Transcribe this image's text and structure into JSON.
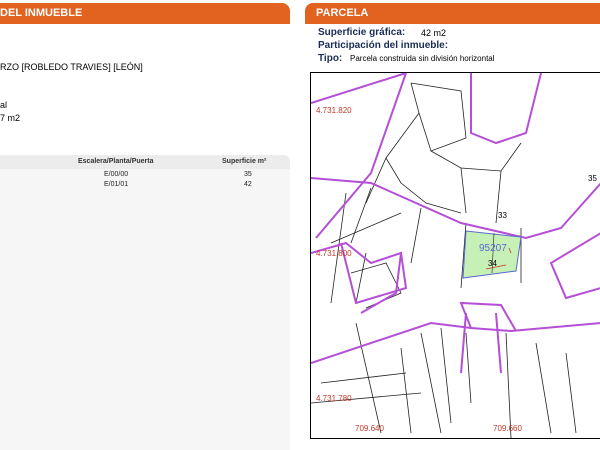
{
  "left_panel": {
    "header": "DEL INMUEBLE",
    "address_line": "RZO [ROBLEDO TRAVIES] [LEÓN]",
    "line1": "al",
    "line2": "7 m2",
    "table": {
      "columns": [
        "Escalera/Planta/Puerta",
        "Superficie m²"
      ],
      "rows": [
        {
          "location": "E/00/00",
          "area": "35"
        },
        {
          "location": "E/01/01",
          "area": "42"
        }
      ]
    }
  },
  "right_panel": {
    "header": "PARCELA",
    "surface_label": "Superficie gráfica:",
    "surface_value": "42 m2",
    "participation_label": "Participación del inmueble:",
    "type_label": "Tipo:",
    "type_value": "Parcela construida sin división horizontal"
  },
  "map": {
    "coord_top": "4.731.820",
    "coord_mid": "4.731.800",
    "coord_bot": "4.731.780",
    "coord_x1": "709.640",
    "coord_x2": "709.660",
    "parcel_ref": "95207",
    "label_34": "34",
    "label_33": "33",
    "label_35": "35",
    "colors": {
      "road": "#b44fd6",
      "parcel_fill": "#c6f0b6",
      "coord_text": "#c0392b",
      "ref_text": "#5a6ad0"
    }
  }
}
